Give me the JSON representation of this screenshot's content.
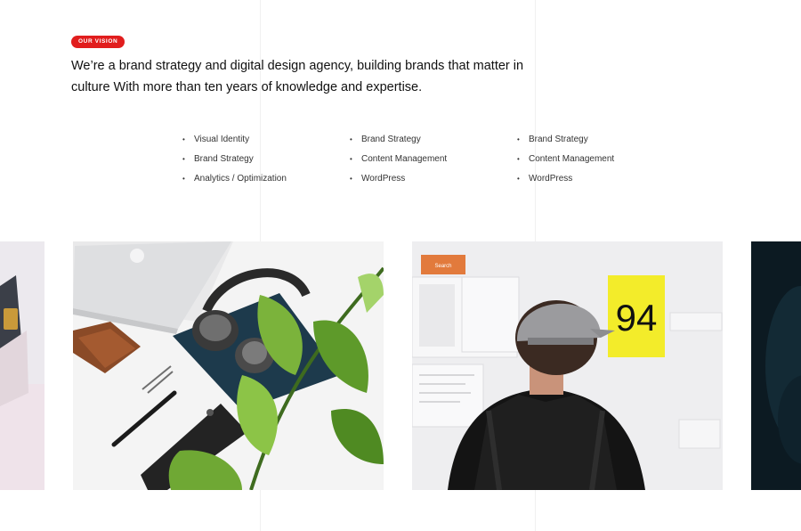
{
  "vision": {
    "badge": "OUR VISION",
    "statement": "We’re a brand strategy and digital design agency, building brands that matter in culture With more than ten years of knowledge and expertise."
  },
  "services": {
    "columns": [
      {
        "items": [
          "Visual Identity",
          "Brand Strategy",
          "Analytics / Optimization"
        ]
      },
      {
        "items": [
          "Brand Strategy",
          "Content Management",
          "WordPress"
        ]
      },
      {
        "items": [
          "Brand Strategy",
          "Content Management",
          "WordPress"
        ]
      }
    ]
  },
  "gallery": {
    "images": [
      {
        "name": "partial-left-photo"
      },
      {
        "name": "workspace-desk-photo"
      },
      {
        "name": "man-at-board-photo",
        "poster_text": "94",
        "sticker_text": "Search"
      },
      {
        "name": "partial-right-photo"
      }
    ]
  }
}
